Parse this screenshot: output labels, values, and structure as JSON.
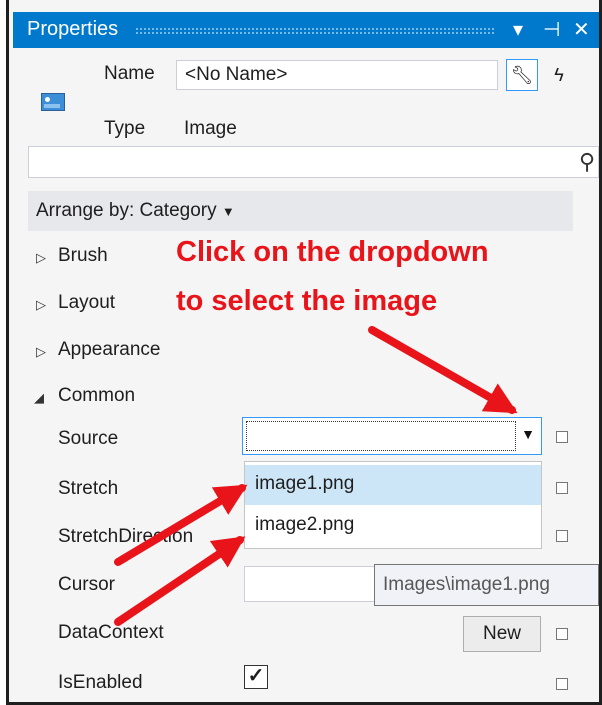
{
  "titlebar": {
    "title": "Properties",
    "icons": [
      "dropdown-arrow-icon",
      "pin-icon",
      "close-icon"
    ],
    "accent": "#0079cc"
  },
  "header": {
    "name_label": "Name",
    "name_value": "<No Name>",
    "type_label": "Type",
    "type_value": "Image"
  },
  "search": {
    "placeholder": ""
  },
  "arrange": {
    "label": "Arrange by: Category"
  },
  "categories": [
    {
      "label": "Brush",
      "expanded": false
    },
    {
      "label": "Layout",
      "expanded": false
    },
    {
      "label": "Appearance",
      "expanded": false
    },
    {
      "label": "Common",
      "expanded": true
    }
  ],
  "properties": {
    "source": "Source",
    "stretch": "Stretch",
    "stretch_direction": "StretchDirection",
    "cursor": "Cursor",
    "data_context": "DataContext",
    "is_enabled": "IsEnabled"
  },
  "dropdown": {
    "items": [
      "image1.png",
      "image2.png"
    ],
    "selected": "image1.png"
  },
  "tooltip": "Images\\image1.png",
  "new_button": "New",
  "is_enabled_checked": true,
  "annotation": {
    "line1": "Click on the dropdown",
    "line2": "to select the image",
    "color": "#e8141a"
  }
}
